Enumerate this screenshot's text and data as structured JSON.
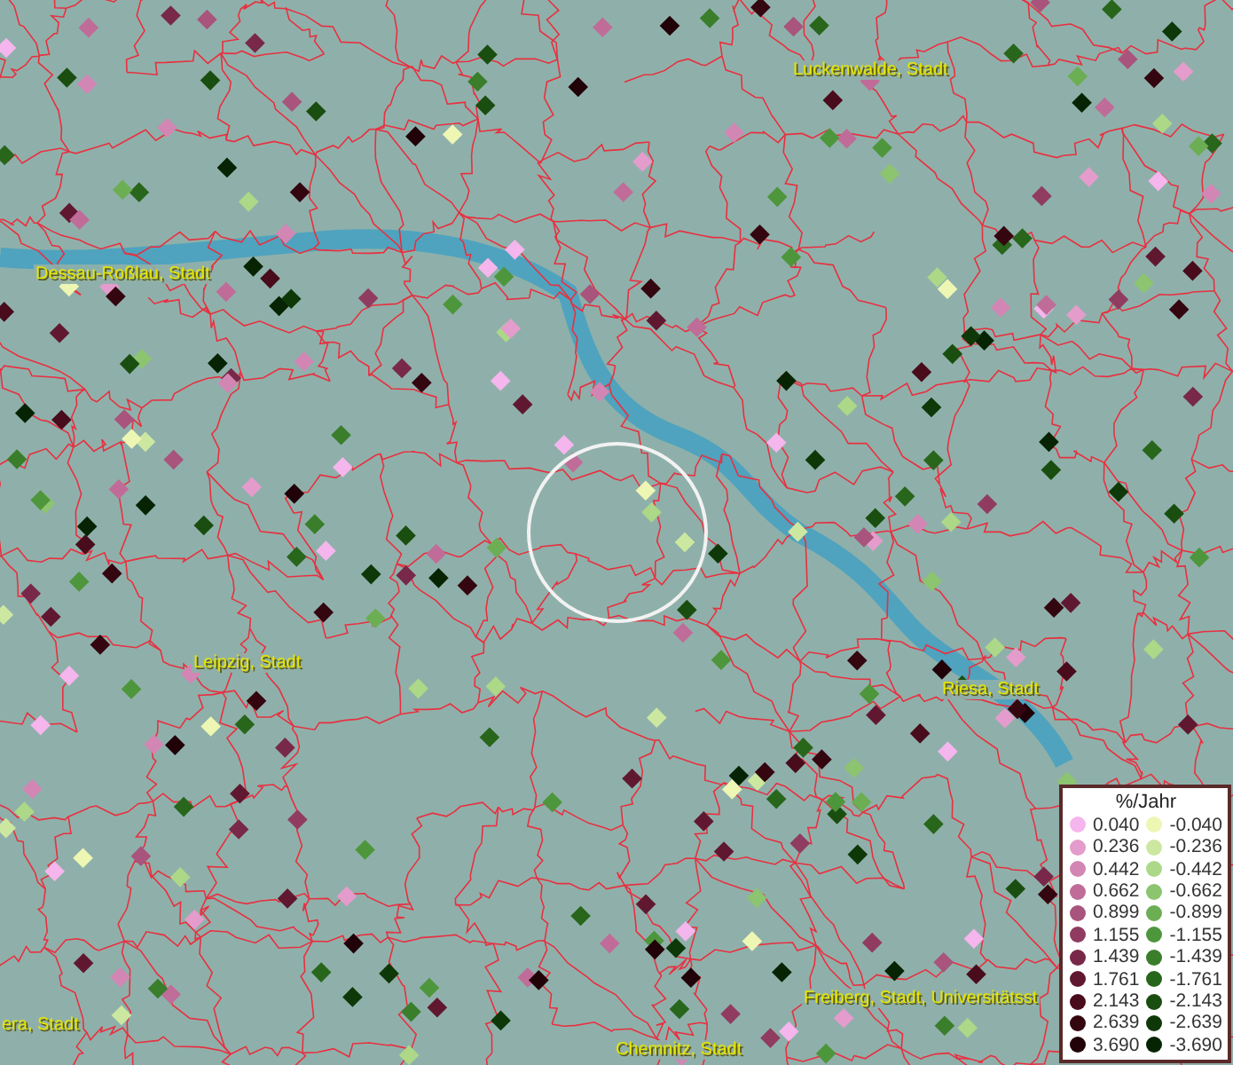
{
  "map": {
    "labels": [
      {
        "text": "Luckenwalde, Stadt"
      },
      {
        "text": "Dessau-Roßlau, Stadt"
      },
      {
        "text": "Leipzig, Stadt"
      },
      {
        "text": "Riesa, Stadt"
      },
      {
        "text": "Freiberg, Stadt, Universitätsst"
      },
      {
        "text": "era, Stadt"
      },
      {
        "text": "Chemnitz, Stadt"
      }
    ]
  },
  "legend": {
    "title": "%/Jahr",
    "column_1": [
      {
        "value": "0.040",
        "color": "#f4b6ec"
      },
      {
        "value": "0.236",
        "color": "#e49ccc"
      },
      {
        "value": "0.442",
        "color": "#d286b4"
      },
      {
        "value": "0.662",
        "color": "#c06c98"
      },
      {
        "value": "0.899",
        "color": "#a8547c"
      },
      {
        "value": "1.155",
        "color": "#903c60"
      },
      {
        "value": "1.439",
        "color": "#782848"
      },
      {
        "value": "1.761",
        "color": "#601830"
      },
      {
        "value": "2.143",
        "color": "#480c1c"
      },
      {
        "value": "2.639",
        "color": "#340610"
      },
      {
        "value": "3.690",
        "color": "#200208"
      }
    ],
    "column_2": [
      {
        "value": "-0.040",
        "color": "#eef6b4"
      },
      {
        "value": "-0.236",
        "color": "#cce8a0"
      },
      {
        "value": "-0.442",
        "color": "#acd888"
      },
      {
        "value": "-0.662",
        "color": "#8cc470"
      },
      {
        "value": "-0.899",
        "color": "#6cae54"
      },
      {
        "value": "-1.155",
        "color": "#4e963c"
      },
      {
        "value": "-1.439",
        "color": "#3a7e2c"
      },
      {
        "value": "-1.761",
        "color": "#28661c"
      },
      {
        "value": "-2.143",
        "color": "#1a4e10"
      },
      {
        "value": "-2.639",
        "color": "#0e3808"
      },
      {
        "value": "-3.690",
        "color": "#062404"
      }
    ]
  }
}
